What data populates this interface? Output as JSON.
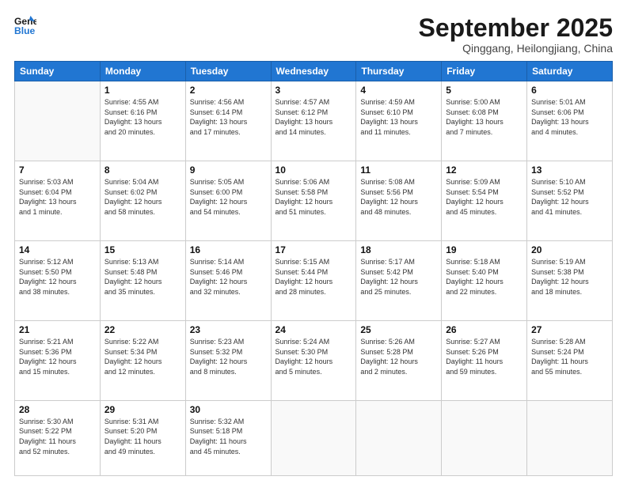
{
  "header": {
    "logo_line1": "General",
    "logo_line2": "Blue",
    "month": "September 2025",
    "location": "Qinggang, Heilongjiang, China"
  },
  "weekdays": [
    "Sunday",
    "Monday",
    "Tuesday",
    "Wednesday",
    "Thursday",
    "Friday",
    "Saturday"
  ],
  "weeks": [
    [
      {
        "day": "",
        "info": ""
      },
      {
        "day": "1",
        "info": "Sunrise: 4:55 AM\nSunset: 6:16 PM\nDaylight: 13 hours\nand 20 minutes."
      },
      {
        "day": "2",
        "info": "Sunrise: 4:56 AM\nSunset: 6:14 PM\nDaylight: 13 hours\nand 17 minutes."
      },
      {
        "day": "3",
        "info": "Sunrise: 4:57 AM\nSunset: 6:12 PM\nDaylight: 13 hours\nand 14 minutes."
      },
      {
        "day": "4",
        "info": "Sunrise: 4:59 AM\nSunset: 6:10 PM\nDaylight: 13 hours\nand 11 minutes."
      },
      {
        "day": "5",
        "info": "Sunrise: 5:00 AM\nSunset: 6:08 PM\nDaylight: 13 hours\nand 7 minutes."
      },
      {
        "day": "6",
        "info": "Sunrise: 5:01 AM\nSunset: 6:06 PM\nDaylight: 13 hours\nand 4 minutes."
      }
    ],
    [
      {
        "day": "7",
        "info": "Sunrise: 5:03 AM\nSunset: 6:04 PM\nDaylight: 13 hours\nand 1 minute."
      },
      {
        "day": "8",
        "info": "Sunrise: 5:04 AM\nSunset: 6:02 PM\nDaylight: 12 hours\nand 58 minutes."
      },
      {
        "day": "9",
        "info": "Sunrise: 5:05 AM\nSunset: 6:00 PM\nDaylight: 12 hours\nand 54 minutes."
      },
      {
        "day": "10",
        "info": "Sunrise: 5:06 AM\nSunset: 5:58 PM\nDaylight: 12 hours\nand 51 minutes."
      },
      {
        "day": "11",
        "info": "Sunrise: 5:08 AM\nSunset: 5:56 PM\nDaylight: 12 hours\nand 48 minutes."
      },
      {
        "day": "12",
        "info": "Sunrise: 5:09 AM\nSunset: 5:54 PM\nDaylight: 12 hours\nand 45 minutes."
      },
      {
        "day": "13",
        "info": "Sunrise: 5:10 AM\nSunset: 5:52 PM\nDaylight: 12 hours\nand 41 minutes."
      }
    ],
    [
      {
        "day": "14",
        "info": "Sunrise: 5:12 AM\nSunset: 5:50 PM\nDaylight: 12 hours\nand 38 minutes."
      },
      {
        "day": "15",
        "info": "Sunrise: 5:13 AM\nSunset: 5:48 PM\nDaylight: 12 hours\nand 35 minutes."
      },
      {
        "day": "16",
        "info": "Sunrise: 5:14 AM\nSunset: 5:46 PM\nDaylight: 12 hours\nand 32 minutes."
      },
      {
        "day": "17",
        "info": "Sunrise: 5:15 AM\nSunset: 5:44 PM\nDaylight: 12 hours\nand 28 minutes."
      },
      {
        "day": "18",
        "info": "Sunrise: 5:17 AM\nSunset: 5:42 PM\nDaylight: 12 hours\nand 25 minutes."
      },
      {
        "day": "19",
        "info": "Sunrise: 5:18 AM\nSunset: 5:40 PM\nDaylight: 12 hours\nand 22 minutes."
      },
      {
        "day": "20",
        "info": "Sunrise: 5:19 AM\nSunset: 5:38 PM\nDaylight: 12 hours\nand 18 minutes."
      }
    ],
    [
      {
        "day": "21",
        "info": "Sunrise: 5:21 AM\nSunset: 5:36 PM\nDaylight: 12 hours\nand 15 minutes."
      },
      {
        "day": "22",
        "info": "Sunrise: 5:22 AM\nSunset: 5:34 PM\nDaylight: 12 hours\nand 12 minutes."
      },
      {
        "day": "23",
        "info": "Sunrise: 5:23 AM\nSunset: 5:32 PM\nDaylight: 12 hours\nand 8 minutes."
      },
      {
        "day": "24",
        "info": "Sunrise: 5:24 AM\nSunset: 5:30 PM\nDaylight: 12 hours\nand 5 minutes."
      },
      {
        "day": "25",
        "info": "Sunrise: 5:26 AM\nSunset: 5:28 PM\nDaylight: 12 hours\nand 2 minutes."
      },
      {
        "day": "26",
        "info": "Sunrise: 5:27 AM\nSunset: 5:26 PM\nDaylight: 11 hours\nand 59 minutes."
      },
      {
        "day": "27",
        "info": "Sunrise: 5:28 AM\nSunset: 5:24 PM\nDaylight: 11 hours\nand 55 minutes."
      }
    ],
    [
      {
        "day": "28",
        "info": "Sunrise: 5:30 AM\nSunset: 5:22 PM\nDaylight: 11 hours\nand 52 minutes."
      },
      {
        "day": "29",
        "info": "Sunrise: 5:31 AM\nSunset: 5:20 PM\nDaylight: 11 hours\nand 49 minutes."
      },
      {
        "day": "30",
        "info": "Sunrise: 5:32 AM\nSunset: 5:18 PM\nDaylight: 11 hours\nand 45 minutes."
      },
      {
        "day": "",
        "info": ""
      },
      {
        "day": "",
        "info": ""
      },
      {
        "day": "",
        "info": ""
      },
      {
        "day": "",
        "info": ""
      }
    ]
  ]
}
